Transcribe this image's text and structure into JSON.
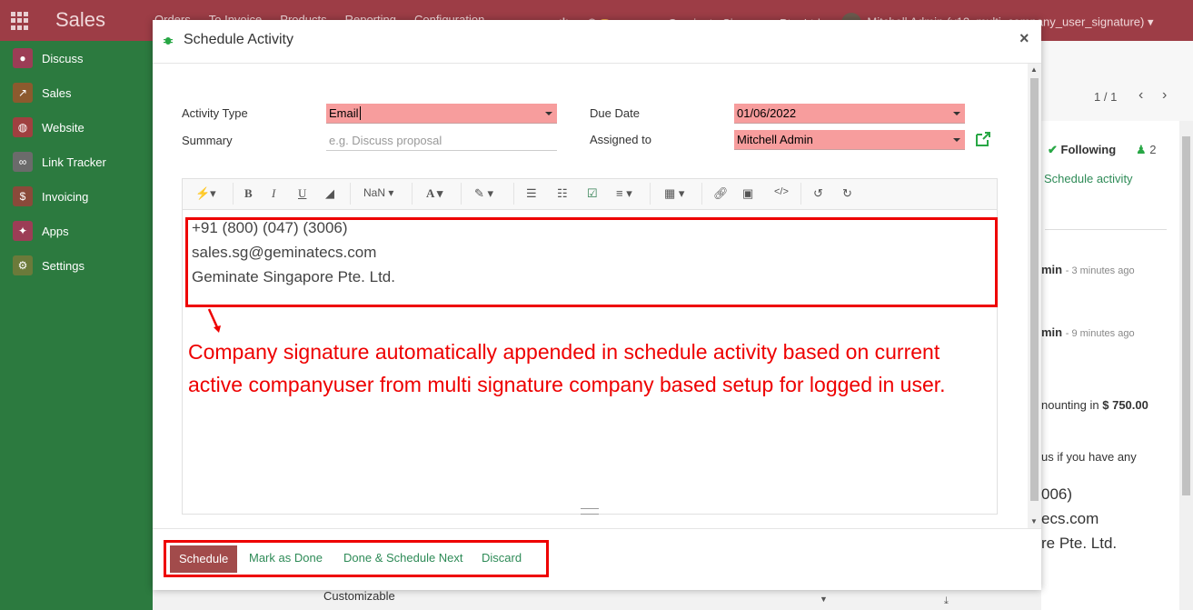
{
  "navbar": {
    "brand": "Sales",
    "menu": [
      "Orders",
      "To Invoice",
      "Products",
      "Reporting",
      "Configuration"
    ],
    "activity_count": "1",
    "message_count": "6",
    "company": "Geminate Singapore Pte. Ltd.",
    "user": "Mitchell Admin (v12_multi_company_user_signature)"
  },
  "sidebar": {
    "items": [
      {
        "label": "Discuss",
        "icon": "chat-icon",
        "color": "#9c3d56"
      },
      {
        "label": "Sales",
        "icon": "chart-icon",
        "color": "#8c5a2e"
      },
      {
        "label": "Website",
        "icon": "globe-icon",
        "color": "#a04040"
      },
      {
        "label": "Link Tracker",
        "icon": "link-icon",
        "color": "#6b6b6b"
      },
      {
        "label": "Invoicing",
        "icon": "invoice-icon",
        "color": "#8a4a3a"
      },
      {
        "label": "Apps",
        "icon": "apps-icon",
        "color": "#9c3d56"
      },
      {
        "label": "Settings",
        "icon": "gear-icon",
        "color": "#6b7a3a"
      }
    ]
  },
  "background": {
    "pager": "1 / 1",
    "following": "Following",
    "followers": "2",
    "schedule_activity": "Schedule activity",
    "msg1_author": "min",
    "msg1_time": "- 3 minutes ago",
    "msg2_author": "min",
    "msg2_time": "- 9 minutes ago",
    "amount_text": "nounting in",
    "amount": "$ 750.00",
    "contact_text": "us if you have any",
    "phone_frag": "006)",
    "email_frag": "ecs.com",
    "company_frag": "re Pte. Ltd.",
    "customizable": "Customizable"
  },
  "modal": {
    "title": "Schedule Activity",
    "close": "×",
    "activity_type_label": "Activity Type",
    "activity_type_value": "Email",
    "summary_label": "Summary",
    "summary_placeholder": "e.g. Discuss proposal",
    "due_date_label": "Due Date",
    "due_date_value": "01/06/2022",
    "assigned_to_label": "Assigned to",
    "assigned_to_value": "Mitchell Admin",
    "toolbar": {
      "font_size": "NaN"
    },
    "signature": {
      "phone": "+91 (800) (047) (3006)",
      "email": "sales.sg@geminatecs.com",
      "company": "Geminate Singapore Pte. Ltd."
    },
    "annotation": "Company signature automatically appended in schedule activity based on current active companyuser from multi signature company based setup for logged in user.",
    "buttons": {
      "schedule": "Schedule",
      "mark_done": "Mark as Done",
      "done_next": "Done & Schedule Next",
      "discard": "Discard"
    }
  },
  "colors": {
    "navbar": "#9d3d46",
    "sidebar": "#2c7a3f",
    "required_field": "#f79d9d",
    "annotation": "#e00000",
    "primary_button": "#a24b4b"
  }
}
